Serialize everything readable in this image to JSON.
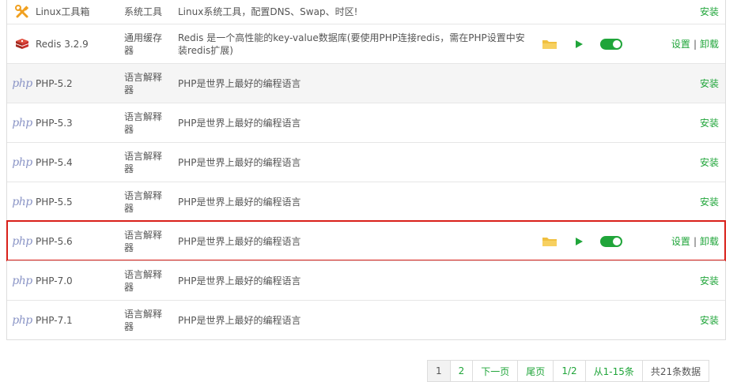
{
  "rows": [
    {
      "icon": "linux-tools-icon",
      "name": "Linux工具箱",
      "type": "系统工具",
      "desc": "Linux系统工具，配置DNS、Swap、时区!",
      "action": "安装",
      "installed": false
    },
    {
      "icon": "redis-icon",
      "name": "Redis 3.2.9",
      "type": "通用缓存器",
      "desc": "Redis 是一个高性能的key-value数据库(要使用PHP连接redis，需在PHP设置中安装redis扩展)",
      "settings": "设置",
      "uninstall": "卸载",
      "installed": true
    },
    {
      "icon": "php-logo-icon",
      "name": "PHP-5.2",
      "type": "语言解释器",
      "desc": "PHP是世界上最好的编程语言",
      "action": "安装",
      "installed": false
    },
    {
      "icon": "php-logo-icon",
      "name": "PHP-5.3",
      "type": "语言解释器",
      "desc": "PHP是世界上最好的编程语言",
      "action": "安装",
      "installed": false
    },
    {
      "icon": "php-logo-icon",
      "name": "PHP-5.4",
      "type": "语言解释器",
      "desc": "PHP是世界上最好的编程语言",
      "action": "安装",
      "installed": false
    },
    {
      "icon": "php-logo-icon",
      "name": "PHP-5.5",
      "type": "语言解释器",
      "desc": "PHP是世界上最好的编程语言",
      "action": "安装",
      "installed": false
    },
    {
      "icon": "php-logo-icon",
      "name": "PHP-5.6",
      "type": "语言解释器",
      "desc": "PHP是世界上最好的编程语言",
      "settings": "设置",
      "uninstall": "卸载",
      "installed": true
    },
    {
      "icon": "php-logo-icon",
      "name": "PHP-7.0",
      "type": "语言解释器",
      "desc": "PHP是世界上最好的编程语言",
      "action": "安装",
      "installed": false
    },
    {
      "icon": "php-logo-icon",
      "name": "PHP-7.1",
      "type": "语言解释器",
      "desc": "PHP是世界上最好的编程语言",
      "action": "安装",
      "installed": false
    }
  ],
  "php_logo_text": "php",
  "action_separator": "|",
  "pagination": {
    "page1": "1",
    "page2": "2",
    "next": "下一页",
    "last": "尾页",
    "page_of": "1/2",
    "range": "从1-15条",
    "total": "共21条数据"
  },
  "colors": {
    "accent_green": "#20a53a",
    "highlight_red": "#d9201a",
    "folder_yellow": "#f0c040",
    "redis_red": "#c9302c",
    "php_purple": "#8a94c6"
  }
}
